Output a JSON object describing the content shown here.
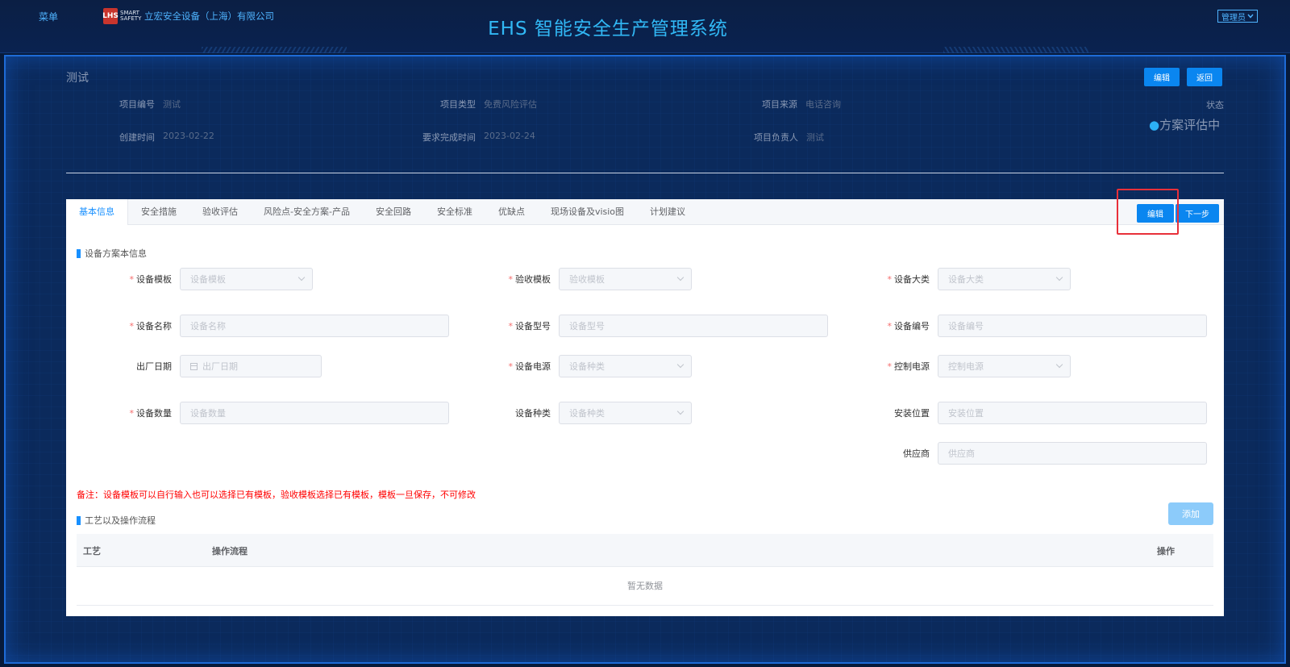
{
  "header": {
    "menu_label": "菜单",
    "logo_badge": "LHS",
    "logo_smart": "SMART SAFETY",
    "company": "立宏安全设备（上海）有限公司",
    "system_title": "EHS 智能安全生产管理系统",
    "admin_label": "管理员"
  },
  "project": {
    "name": "测试",
    "edit_label": "编辑",
    "back_label": "返回",
    "fields": {
      "code_label": "项目编号",
      "code": "测试",
      "type_label": "项目类型",
      "type": "免费风险评估",
      "source_label": "项目来源",
      "source": "电话咨询",
      "created_label": "创建时间",
      "created": "2023-02-22",
      "due_label": "要求完成时间",
      "due": "2023-02-24",
      "owner_label": "项目负责人",
      "owner": "测试"
    },
    "status_label": "状态",
    "status_dot": "●",
    "status": "方案评估中"
  },
  "tabs": [
    "基本信息",
    "安全措施",
    "验收评估",
    "风险点-安全方案-产品",
    "安全回路",
    "安全标准",
    "优缺点",
    "现场设备及visio图",
    "计划建议"
  ],
  "tab_actions": {
    "edit_label": "编辑",
    "next_label": "下一步"
  },
  "section1_title": "设备方案本信息",
  "form": {
    "template": {
      "label": "设备模板",
      "placeholder": "设备模板"
    },
    "acceptance": {
      "label": "验收模板",
      "placeholder": "验收模板"
    },
    "category": {
      "label": "设备大类",
      "placeholder": "设备大类"
    },
    "name": {
      "label": "设备名称",
      "placeholder": "设备名称"
    },
    "model": {
      "label": "设备型号",
      "placeholder": "设备型号"
    },
    "number": {
      "label": "设备编号",
      "placeholder": "设备编号"
    },
    "date": {
      "label": "出厂日期",
      "placeholder": "出厂日期"
    },
    "power": {
      "label": "设备电源",
      "placeholder": "设备种类"
    },
    "control": {
      "label": "控制电源",
      "placeholder": "控制电源"
    },
    "quantity": {
      "label": "设备数量",
      "placeholder": "设备数量"
    },
    "kind": {
      "label": "设备种类",
      "placeholder": "设备种类"
    },
    "location": {
      "label": "安装位置",
      "placeholder": "安装位置"
    },
    "supplier": {
      "label": "供应商",
      "placeholder": "供应商"
    }
  },
  "note": "备注：设备模板可以自行输入也可以选择已有模板，验收模板选择已有模板，模板一旦保存，不可修改",
  "section2_title": "工艺以及操作流程",
  "add_label": "添加",
  "table": {
    "col_process": "工艺",
    "col_flow": "操作流程",
    "col_action": "操作",
    "empty": "暂无数据"
  },
  "colors": {
    "accent": "#0a86f0",
    "required": "#f56c6c",
    "title": "#31b8f5",
    "highlight": "#e8303a"
  }
}
